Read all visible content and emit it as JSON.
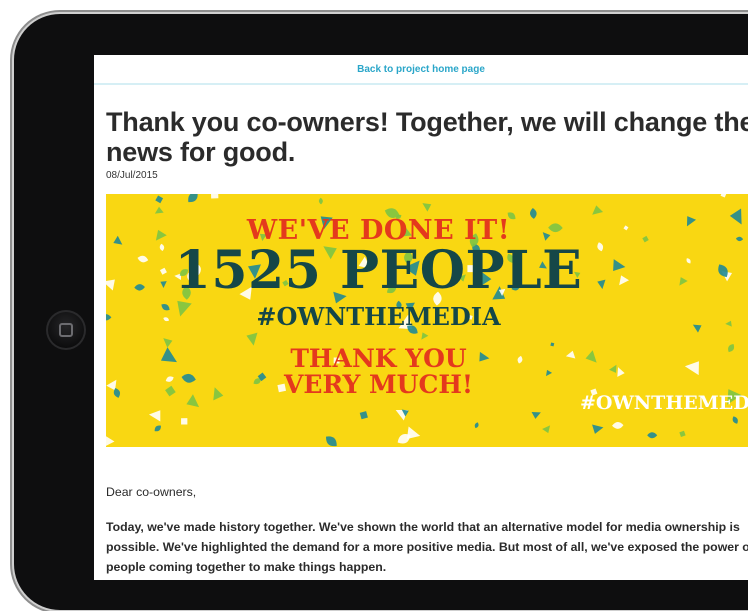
{
  "nav": {
    "back_link": "Back to project home page"
  },
  "post": {
    "title": "Thank you co-owners! Together, we will change the news for good.",
    "date": "08/Jul/2015"
  },
  "banner": {
    "line1": "WE'VE DONE IT!",
    "line2": "1525 PEOPLE",
    "line3": "#OWNTHEMEDIA",
    "line4": "THANK YOU",
    "line5": "VERY MUCH!",
    "hashtag": "#OWNTHEMEDIA",
    "colors": {
      "background": "#f9d712",
      "red": "#e4391d",
      "dark_teal": "#154748",
      "confetti_teal": "#1f8a96",
      "confetti_green": "#7cc445"
    }
  },
  "content": {
    "greeting": "Dear co-owners,",
    "paragraph": "Today, we've made history together. We've shown the world that an alternative model for media ownership is possible. We've highlighted the demand for a more positive media. But most of all, we've exposed the power of people coming together to make things happen."
  },
  "device": {
    "home_button_icon": "square-icon"
  }
}
